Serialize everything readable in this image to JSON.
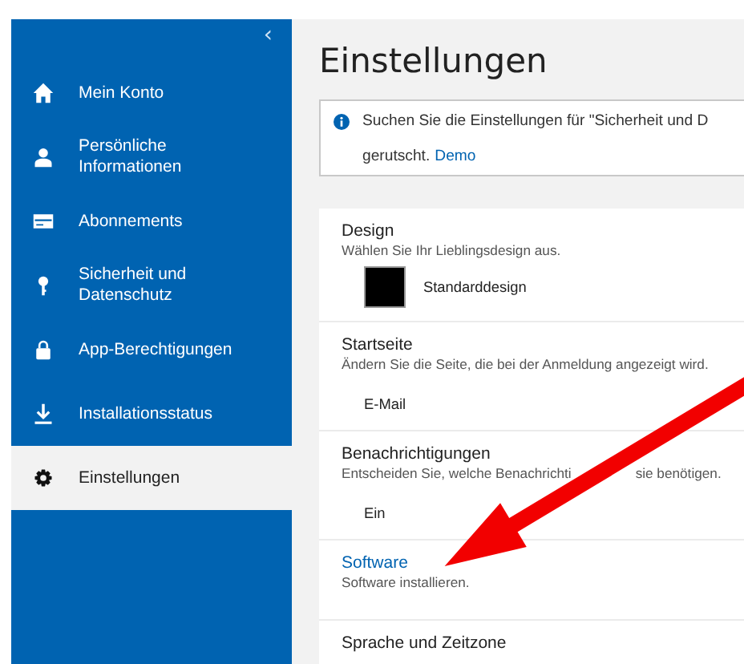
{
  "sidebar": {
    "collapse_glyph": "‹",
    "items": [
      {
        "label": "Mein Konto",
        "selected": false
      },
      {
        "label": "Persönliche Informationen",
        "selected": false
      },
      {
        "label": "Abonnements",
        "selected": false
      },
      {
        "label": "Sicherheit und Datenschutz",
        "selected": false
      },
      {
        "label": "App-Berechtigungen",
        "selected": false
      },
      {
        "label": "Installationsstatus",
        "selected": false
      },
      {
        "label": "Einstellungen",
        "selected": true
      }
    ]
  },
  "page_title": "Einstellungen",
  "info": {
    "line_1": "Suchen Sie die Einstellungen für \"Sicherheit und D",
    "line_2": "gerutscht.",
    "link": "Demo"
  },
  "sections": [
    {
      "kind": "swatch",
      "title": "Design",
      "description": "Wählen Sie Ihr Lieblingsdesign aus.",
      "value": "Standarddesign",
      "color": "#000000"
    },
    {
      "kind": "value",
      "title": "Startseite",
      "description": "Ändern Sie die Seite, die bei der Anmeldung angezeigt wird.",
      "value": "E-Mail"
    },
    {
      "kind": "covered",
      "title": "Benachrichtigungen",
      "description_before": "Entscheiden Sie, welche Benachrichti",
      "description_after": "sie benötigen.",
      "value": "Ein"
    },
    {
      "kind": "link",
      "title": "Software",
      "description": "Software installieren."
    },
    {
      "kind": "plain",
      "title": "Sprache und Zeitzone"
    }
  ]
}
